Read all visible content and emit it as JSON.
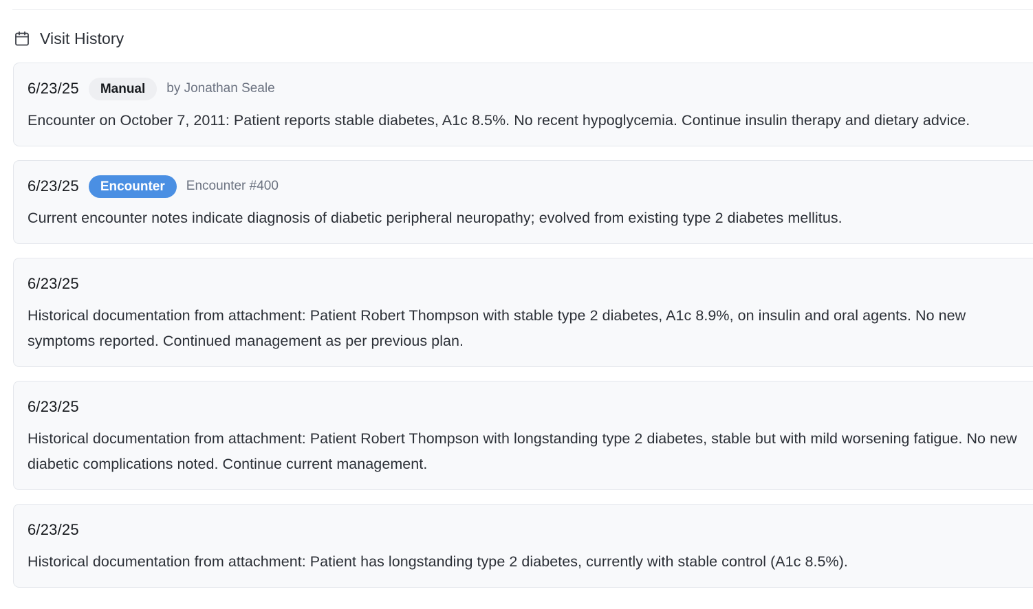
{
  "section": {
    "title": "Visit History",
    "icon": "calendar-icon"
  },
  "colors": {
    "encounter_badge": "#4a8fe3",
    "manual_badge": "#eeeff2",
    "card_background": "#f8f9fb"
  },
  "visits": [
    {
      "date": "6/23/25",
      "badge": "Manual",
      "meta": "by Jonathan Seale",
      "text": "Encounter on October 7, 2011: Patient reports stable diabetes, A1c 8.5%. No recent hypoglycemia. Continue insulin therapy and dietary advice."
    },
    {
      "date": "6/23/25",
      "badge": "Encounter",
      "meta": "Encounter #400",
      "text": "Current encounter notes indicate diagnosis of diabetic peripheral neuropathy; evolved from existing type 2 diabetes mellitus."
    },
    {
      "date": "6/23/25",
      "text": "Historical documentation from attachment: Patient Robert Thompson with stable type 2 diabetes, A1c 8.9%, on insulin and oral agents. No new symptoms reported. Continued management as per previous plan."
    },
    {
      "date": "6/23/25",
      "text": "Historical documentation from attachment: Patient Robert Thompson with longstanding type 2 diabetes, stable but with mild worsening fatigue. No new diabetic complications noted. Continue current management."
    },
    {
      "date": "6/23/25",
      "text": "Historical documentation from attachment: Patient has longstanding type 2 diabetes, currently with stable control (A1c 8.5%)."
    }
  ]
}
